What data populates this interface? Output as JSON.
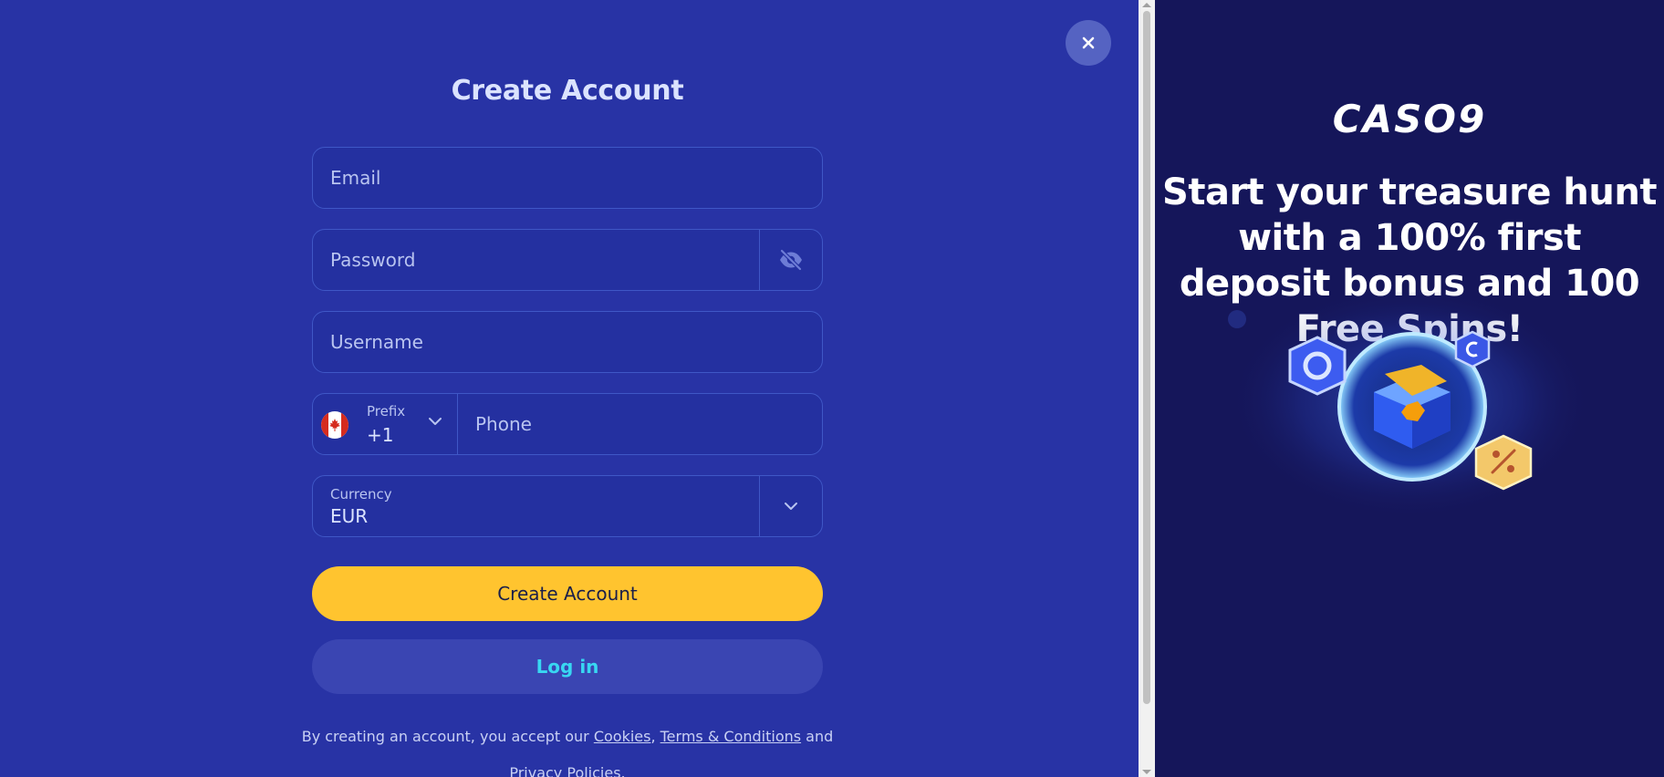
{
  "form": {
    "title": "Create Account",
    "email_placeholder": "Email",
    "password_placeholder": "Password",
    "username_placeholder": "Username",
    "prefix_label": "Prefix",
    "prefix_value": "+1",
    "phone_placeholder": "Phone",
    "currency_label": "Currency",
    "currency_value": "EUR",
    "create_button": "Create Account",
    "login_button": "Log in",
    "close_label": "×"
  },
  "terms": {
    "prefix": "By creating an account, you accept our ",
    "cookies": "Cookies",
    "comma": ", ",
    "terms_conditions": "Terms & Conditions",
    "and": " and",
    "privacy": "Privacy Policies",
    "period": "."
  },
  "promo": {
    "logo": "CASO9",
    "headline": "Start your treasure hunt with a 100% first deposit bonus and 100 Free Spins!"
  },
  "icons": {
    "close": "close-icon",
    "password_toggle": "eye-off-icon",
    "prefix_dropdown": "chevron-down-icon",
    "currency_dropdown": "chevron-down-icon",
    "flag": "canada-flag-icon"
  },
  "colors": {
    "form_bg": "#2833a5",
    "promo_bg": "#15165a",
    "primary_button": "#ffc42f",
    "login_text": "#38d7f2"
  }
}
